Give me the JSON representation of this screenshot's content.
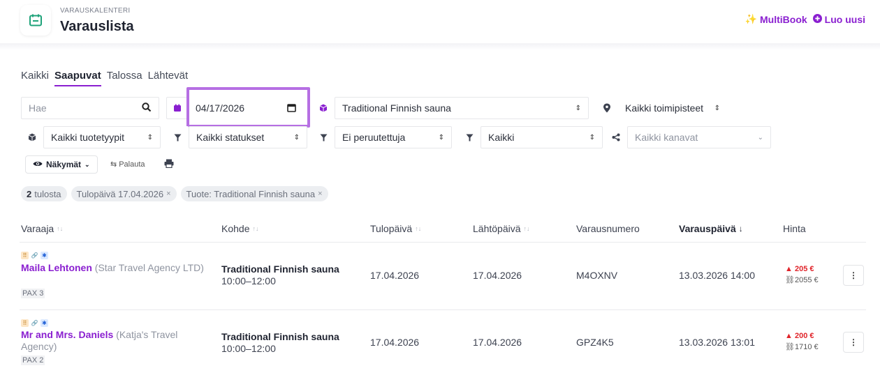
{
  "header": {
    "supertitle": "VARAUSKALENTERI",
    "title": "Varauslista",
    "multibook_label": "MultiBook",
    "new_label": "Luo uusi"
  },
  "tabs": [
    {
      "label": "Kaikki",
      "active": false
    },
    {
      "label": "Saapuvat",
      "active": true
    },
    {
      "label": "Talossa",
      "active": false
    },
    {
      "label": "Lähtevät",
      "active": false
    }
  ],
  "filters": {
    "search_placeholder": "Hae",
    "date_value": "04/17/2026",
    "product_value": "Traditional Finnish sauna",
    "location_value": "Kaikki toimipisteet",
    "product_type_value": "Kaikki tuotetyypit",
    "status_value": "Kaikki statukset",
    "cancel_value": "Ei peruutettuja",
    "other_value": "Kaikki",
    "channel_placeholder": "Kaikki kanavat"
  },
  "toolbar": {
    "views_label": "Näkymät",
    "reset_label": "Palauta"
  },
  "chips": {
    "count": "2",
    "count_suffix": "tulosta",
    "date_chip": "Tulopäivä 17.04.2026",
    "product_chip": "Tuote: Traditional Finnish sauna"
  },
  "table": {
    "headers": {
      "booker": "Varaaja",
      "product": "Kohde",
      "arrival": "Tulopäivä",
      "departure": "Lähtöpäivä",
      "number": "Varausnumero",
      "booking_date": "Varauspäivä",
      "price": "Hinta"
    },
    "rows": [
      {
        "name": "Maila Lehtonen",
        "agency": "(Star Travel Agency LTD)",
        "pax": "PAX 3",
        "product": "Traditional Finnish sauna",
        "time": "10:00–12:00",
        "arrival": "17.04.2026",
        "departure": "17.04.2026",
        "number": "M4OXNV",
        "booking_date": "13.03.2026 14:00",
        "price_due": "205 €",
        "price_link": "2055 €"
      },
      {
        "name": "Mr and Mrs. Daniels",
        "agency": "(Katja's Travel Agency)",
        "pax": "PAX 2",
        "product": "Traditional Finnish sauna",
        "time": "10:00–12:00",
        "arrival": "17.04.2026",
        "departure": "17.04.2026",
        "number": "GPZ4K5",
        "booking_date": "13.03.2026 13:01",
        "price_due": "200 €",
        "price_link": "1710 €"
      }
    ]
  },
  "colors": {
    "accent": "#8a1fd0",
    "highlight": "#b66fe3",
    "warning": "#e0242a",
    "app_icon": "#1fa37a"
  }
}
